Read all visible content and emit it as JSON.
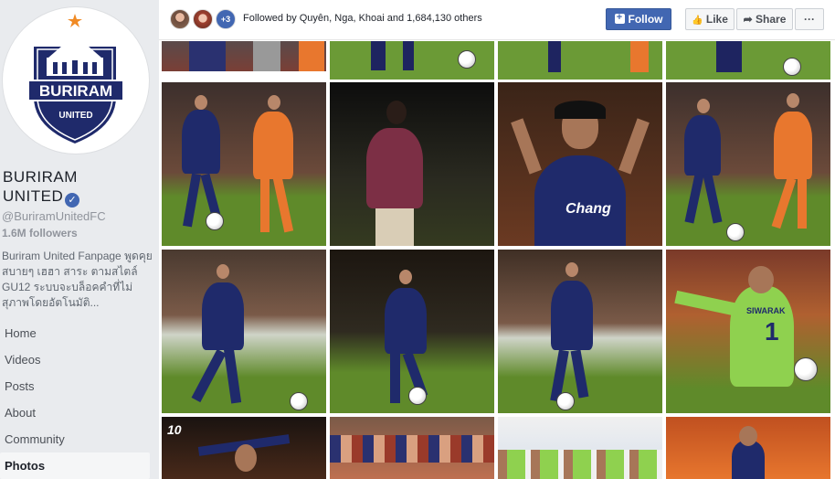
{
  "page": {
    "name_line1": "BURIRAM",
    "name_line2": "UNITED",
    "handle": "@BuriramUnitedFC",
    "followers": "1.6M followers",
    "about": "Buriram United Fanpage พูดคุย สบายๆ เฮฮา สาระ ตามสไตล์ GU12 ระบบจะบล็อคคำที่ไม่สุภาพโดยอัตโนมัติ...",
    "logo_text": "BURIRAM",
    "logo_subtext": "UNITED"
  },
  "nav": {
    "items": [
      {
        "label": "Home",
        "active": false
      },
      {
        "label": "Videos",
        "active": false
      },
      {
        "label": "Posts",
        "active": false
      },
      {
        "label": "About",
        "active": false
      },
      {
        "label": "Community",
        "active": false
      },
      {
        "label": "Photos",
        "active": true
      }
    ]
  },
  "topbar": {
    "followed_text": "Followed by Quyên, Nga, Khoai and 1,684,130 others",
    "more_faces_label": "+3",
    "follow_label": "Follow",
    "like_label": "Like",
    "share_label": "Share",
    "more_label": "···"
  },
  "photos": {
    "jersey_text": "Chang",
    "keeper_name": "SIWARAK",
    "keeper_number": "1",
    "anniversary_text": "10"
  },
  "colors": {
    "brand_blue": "#4267b2",
    "club_navy": "#1f2a6b",
    "opponent_orange": "#e8772e",
    "keeper_green": "#8fd14f",
    "pitch_green": "#5f8a2a"
  }
}
